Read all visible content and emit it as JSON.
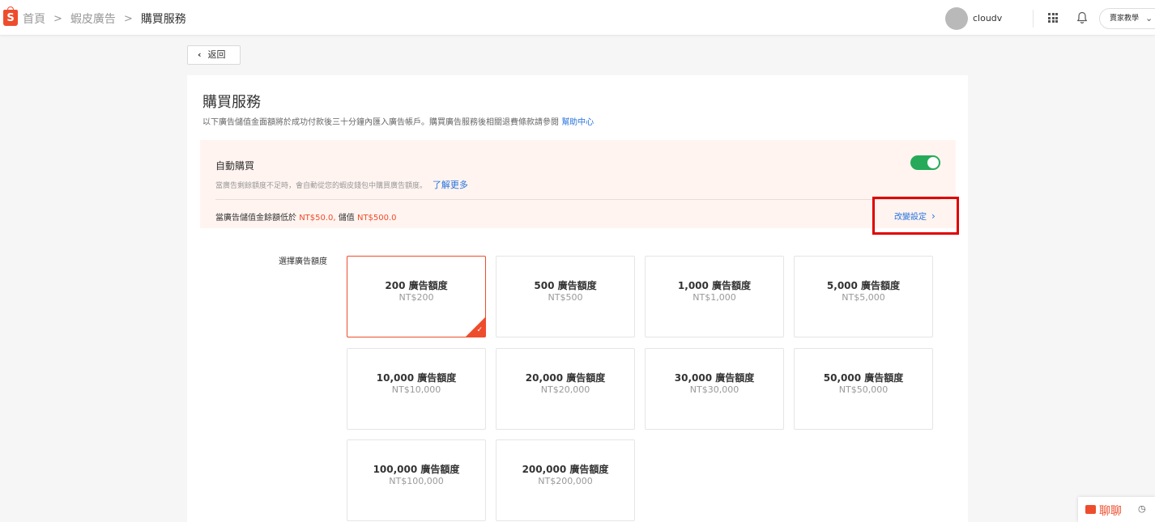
{
  "breadcrumb": {
    "items": [
      "首頁",
      "蝦皮廣告",
      "購買服務"
    ],
    "separator": ">"
  },
  "header": {
    "username": "cloudv",
    "seller_label": "賣家教學"
  },
  "back_label": "返回",
  "page": {
    "title": "購買服務",
    "subtitle": "以下廣告儲值金面額將於成功付款後三十分鐘內匯入廣告帳戶。購買廣告服務後相關退費條款請參閱",
    "help_link": "幫助中心"
  },
  "auto_purchase": {
    "title": "自動購買",
    "enabled": true,
    "description": "當廣告剩餘額度不足時，會自動從您的蝦皮錢包中購買廣告額度。",
    "learn_more": "了解更多",
    "rule_prefix": "當廣告儲值金餘額低於",
    "threshold": "NT$50.0,",
    "rule_middle": "儲值",
    "topup": "NT$500.0",
    "change_label": "改變設定"
  },
  "amount_label": "選擇廣告額度",
  "options": [
    {
      "amount": "200 廣告額度",
      "price": "NT$200",
      "selected": true
    },
    {
      "amount": "500 廣告額度",
      "price": "NT$500",
      "selected": false
    },
    {
      "amount": "1,000 廣告額度",
      "price": "NT$1,000",
      "selected": false
    },
    {
      "amount": "5,000 廣告額度",
      "price": "NT$5,000",
      "selected": false
    },
    {
      "amount": "10,000 廣告額度",
      "price": "NT$10,000",
      "selected": false
    },
    {
      "amount": "20,000 廣告額度",
      "price": "NT$20,000",
      "selected": false
    },
    {
      "amount": "30,000 廣告額度",
      "price": "NT$30,000",
      "selected": false
    },
    {
      "amount": "50,000 廣告額度",
      "price": "NT$50,000",
      "selected": false
    },
    {
      "amount": "100,000 廣告額度",
      "price": "NT$100,000",
      "selected": false
    },
    {
      "amount": "200,000 廣告額度",
      "price": "NT$200,000",
      "selected": false
    }
  ],
  "chat": {
    "label": "聊聊"
  },
  "colors": {
    "brand": "#ee4d2d",
    "link": "#2673dd",
    "toggle_on": "#26aa5a",
    "highlight": "#e00000"
  }
}
